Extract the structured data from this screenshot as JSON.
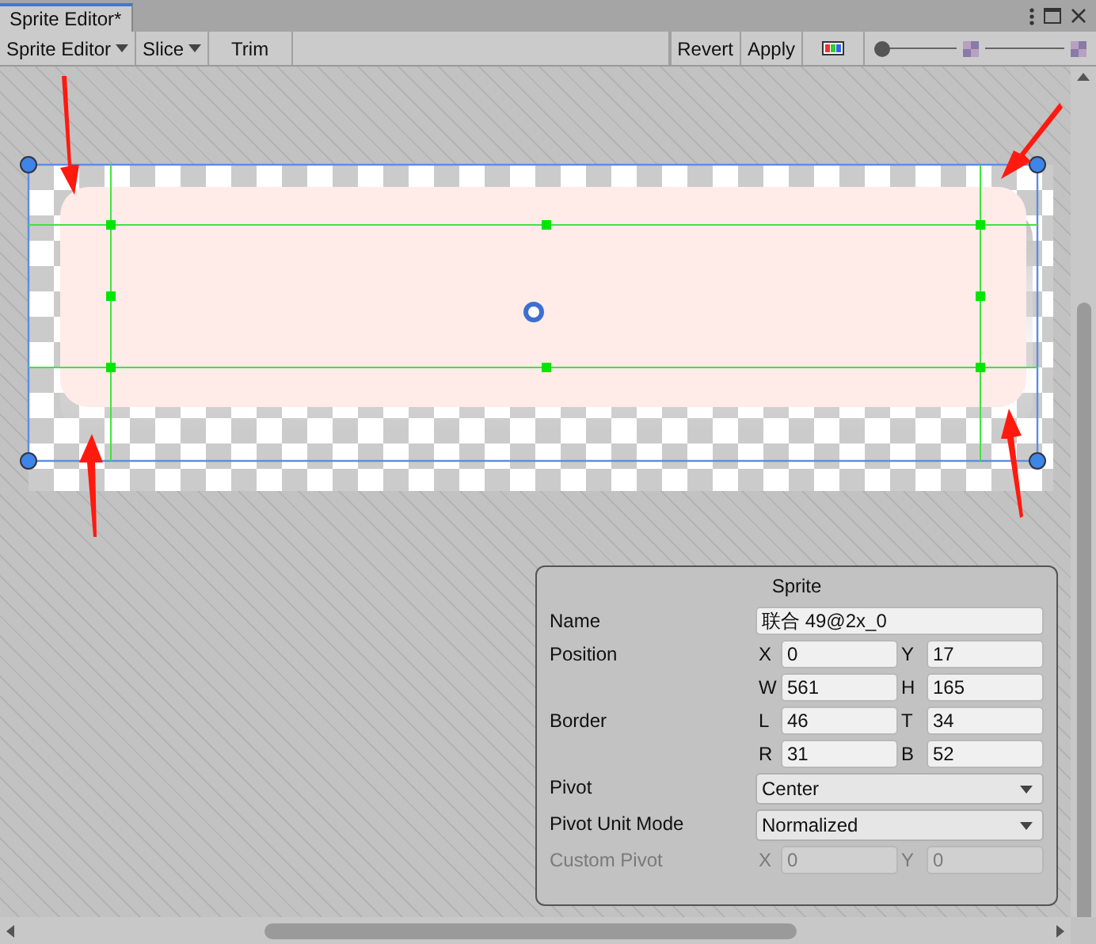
{
  "tab": {
    "title": "Sprite Editor*",
    "selected": true
  },
  "toolbar": {
    "left": [
      {
        "label": "Sprite Editor",
        "kind": "dropdown"
      },
      {
        "label": "Slice",
        "kind": "dropdown"
      },
      {
        "label": "Trim",
        "kind": "button"
      }
    ],
    "right": [
      {
        "label": "Revert"
      },
      {
        "label": "Apply"
      }
    ],
    "zoom_slider": {
      "level": 0
    }
  },
  "sprite_panel": {
    "title": "Sprite",
    "rows": [
      {
        "label": "Name",
        "kind": "text",
        "value": "联合 49@2x_0",
        "disabled": false
      },
      {
        "label": "Position",
        "kind": "pairs",
        "disabled": false,
        "pairs": [
          [
            {
              "axis": "X",
              "value": "0"
            },
            {
              "axis": "Y",
              "value": "17"
            }
          ],
          [
            {
              "axis": "W",
              "value": "561"
            },
            {
              "axis": "H",
              "value": "165"
            }
          ]
        ]
      },
      {
        "label": "Border",
        "kind": "pairs",
        "disabled": false,
        "pairs": [
          [
            {
              "axis": "L",
              "value": "46"
            },
            {
              "axis": "T",
              "value": "34"
            }
          ],
          [
            {
              "axis": "R",
              "value": "31"
            },
            {
              "axis": "B",
              "value": "52"
            }
          ]
        ]
      },
      {
        "label": "Pivot",
        "kind": "dropdown",
        "value": "Center",
        "disabled": false
      },
      {
        "label": "Pivot Unit Mode",
        "kind": "dropdown",
        "value": "Normalized",
        "disabled": false
      },
      {
        "label": "Custom Pivot",
        "kind": "pairs",
        "disabled": true,
        "pairs": [
          [
            {
              "axis": "X",
              "value": "0"
            },
            {
              "axis": "Y",
              "value": "0"
            }
          ]
        ]
      }
    ]
  }
}
